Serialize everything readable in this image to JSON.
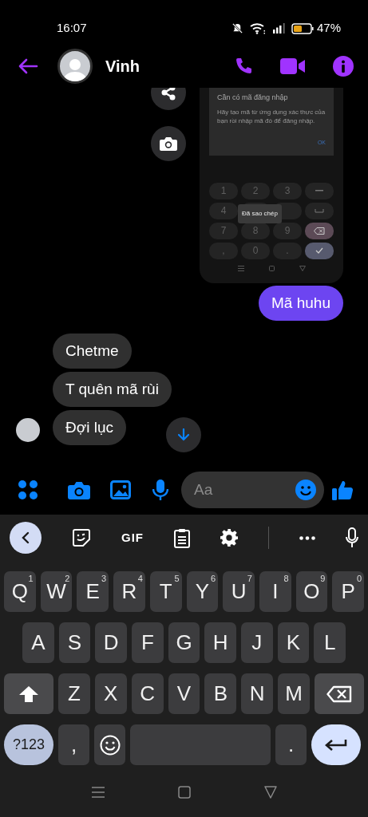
{
  "status_bar": {
    "time": "16:07",
    "battery": "47%"
  },
  "header": {
    "contact_name": "Vinh"
  },
  "messages": [
    {
      "kind": "image",
      "screenshot": {
        "dialog_title": "Cần có mã đăng nhập",
        "dialog_body": "Hãy tạo mã từ ứng dụng xác thực của bạn rồi nhập mã đó để đăng nhập.",
        "dialog_button": "OK",
        "toast": "Đã sao chép",
        "keys": [
          {
            "kind": "digit",
            "label": "1"
          },
          {
            "kind": "digit",
            "label": "2"
          },
          {
            "kind": "digit",
            "label": "3"
          },
          {
            "kind": "dash"
          },
          {
            "kind": "digit",
            "label": "4"
          },
          {
            "kind": "covered"
          },
          {
            "kind": "covered"
          },
          {
            "kind": "space"
          },
          {
            "kind": "digit",
            "label": "7"
          },
          {
            "kind": "digit",
            "label": "8"
          },
          {
            "kind": "digit",
            "label": "9"
          },
          {
            "kind": "backspace"
          },
          {
            "kind": "digit",
            "label": ","
          },
          {
            "kind": "digit",
            "label": "0"
          },
          {
            "kind": "digit",
            "label": "."
          },
          {
            "kind": "done"
          }
        ]
      }
    },
    {
      "kind": "sent",
      "text": "Mã huhu"
    },
    {
      "kind": "received",
      "text": "Chetme"
    },
    {
      "kind": "received",
      "text": "T quên mã rùi"
    },
    {
      "kind": "received",
      "text": "Đợi lục"
    }
  ],
  "composer": {
    "placeholder": "Aa"
  },
  "keyboard": {
    "toolbar_gif": "GIF",
    "key_rows": [
      {
        "keys": [
          {
            "kind": "letter",
            "label": "Q",
            "hint": "1"
          },
          {
            "kind": "letter",
            "label": "W",
            "hint": "2"
          },
          {
            "kind": "letter",
            "label": "E",
            "hint": "3"
          },
          {
            "kind": "letter",
            "label": "R",
            "hint": "4"
          },
          {
            "kind": "letter",
            "label": "T",
            "hint": "5"
          },
          {
            "kind": "letter",
            "label": "Y",
            "hint": "6"
          },
          {
            "kind": "letter",
            "label": "U",
            "hint": "7"
          },
          {
            "kind": "letter",
            "label": "I",
            "hint": "8"
          },
          {
            "kind": "letter",
            "label": "O",
            "hint": "9"
          },
          {
            "kind": "letter",
            "label": "P",
            "hint": "0"
          }
        ]
      },
      {
        "keys": [
          {
            "kind": "letter",
            "label": "A"
          },
          {
            "kind": "letter",
            "label": "S"
          },
          {
            "kind": "letter",
            "label": "D"
          },
          {
            "kind": "letter",
            "label": "F"
          },
          {
            "kind": "letter",
            "label": "G"
          },
          {
            "kind": "letter",
            "label": "H"
          },
          {
            "kind": "letter",
            "label": "J"
          },
          {
            "kind": "letter",
            "label": "K"
          },
          {
            "kind": "letter",
            "label": "L"
          }
        ]
      },
      {
        "keys": [
          {
            "kind": "shift"
          },
          {
            "kind": "letter",
            "label": "Z"
          },
          {
            "kind": "letter",
            "label": "X"
          },
          {
            "kind": "letter",
            "label": "C"
          },
          {
            "kind": "letter",
            "label": "V"
          },
          {
            "kind": "letter",
            "label": "B"
          },
          {
            "kind": "letter",
            "label": "N"
          },
          {
            "kind": "letter",
            "label": "M"
          },
          {
            "kind": "backspace"
          }
        ]
      },
      {
        "keys": [
          {
            "kind": "symbols",
            "label": "?123"
          },
          {
            "kind": "punct",
            "label": ","
          },
          {
            "kind": "emoji"
          },
          {
            "kind": "space"
          },
          {
            "kind": "punct",
            "label": "."
          },
          {
            "kind": "enter"
          }
        ]
      }
    ]
  }
}
